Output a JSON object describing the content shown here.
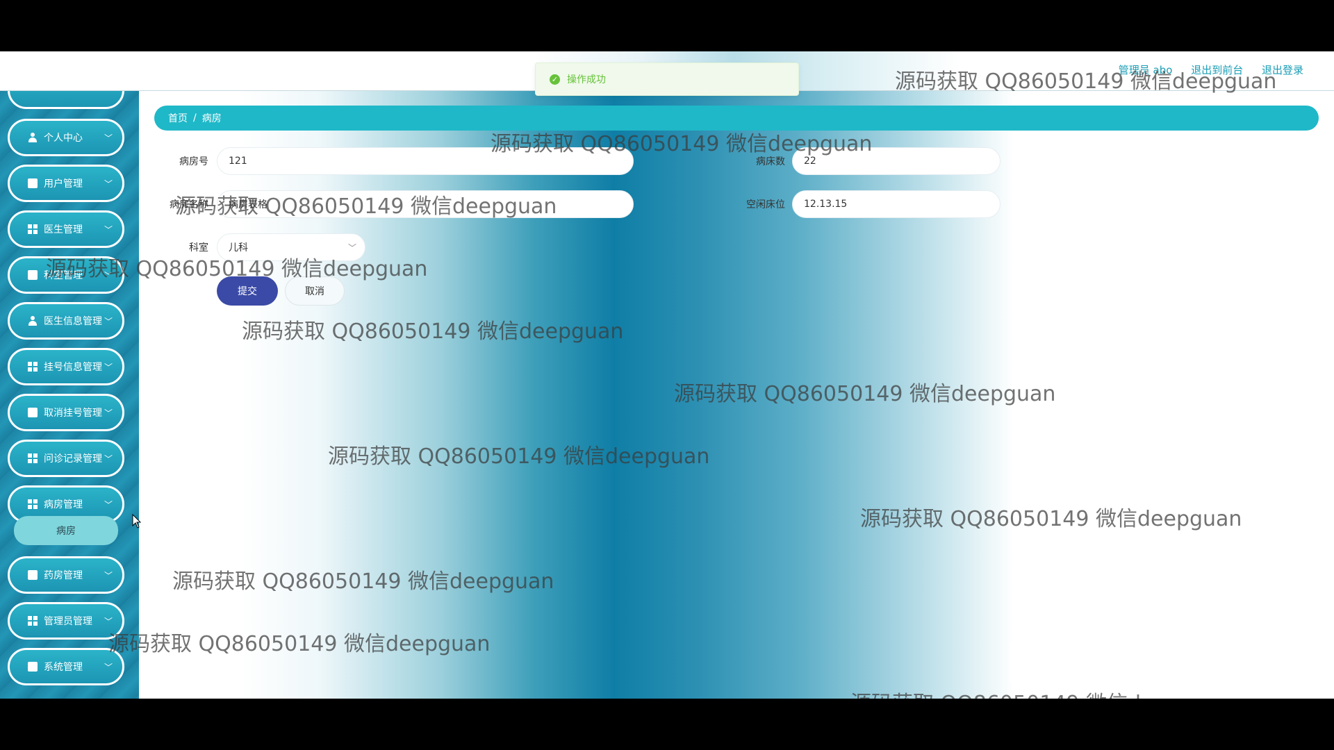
{
  "header": {
    "user_label": "管理员 abo",
    "to_frontend": "退出到前台",
    "logout": "退出登录"
  },
  "toast": {
    "message": "操作成功",
    "icon": "check-circle-icon",
    "color": "#67c23a"
  },
  "sidebar": {
    "items": [
      {
        "label": "个人中心",
        "icon": "user-icon"
      },
      {
        "label": "用户管理",
        "icon": "briefcase-icon"
      },
      {
        "label": "医生管理",
        "icon": "grid-icon"
      },
      {
        "label": "科室管理",
        "icon": "clipboard-icon"
      },
      {
        "label": "医生信息管理",
        "icon": "user-icon"
      },
      {
        "label": "挂号信息管理",
        "icon": "grid-icon"
      },
      {
        "label": "取消挂号管理",
        "icon": "thumb-icon"
      },
      {
        "label": "问诊记录管理",
        "icon": "grid-icon"
      },
      {
        "label": "病房管理",
        "icon": "grid-icon"
      },
      {
        "label": "药房管理",
        "icon": "ticket-icon"
      },
      {
        "label": "管理员管理",
        "icon": "grid-icon"
      },
      {
        "label": "系统管理",
        "icon": "book-icon"
      }
    ],
    "active_sub": "病房"
  },
  "breadcrumb": {
    "home": "首页",
    "separator": "/",
    "current": "病房"
  },
  "form": {
    "room_no_label": "病房号",
    "room_no_value": "121",
    "bed_count_label": "病床数",
    "bed_count_value": "22",
    "room_name_label": "病房名称",
    "room_name_value": "病房表格",
    "free_beds_label": "空闲床位",
    "free_beds_value": "12.13.15",
    "department_label": "科室",
    "department_value": "儿科",
    "submit": "提交",
    "cancel": "取消"
  },
  "watermark": "源码获取 QQ86050149 微信deepguan",
  "colors": {
    "accent": "#1fb8c8",
    "primary_button": "#3b4aa6",
    "sidebar": "#1e86a6"
  }
}
